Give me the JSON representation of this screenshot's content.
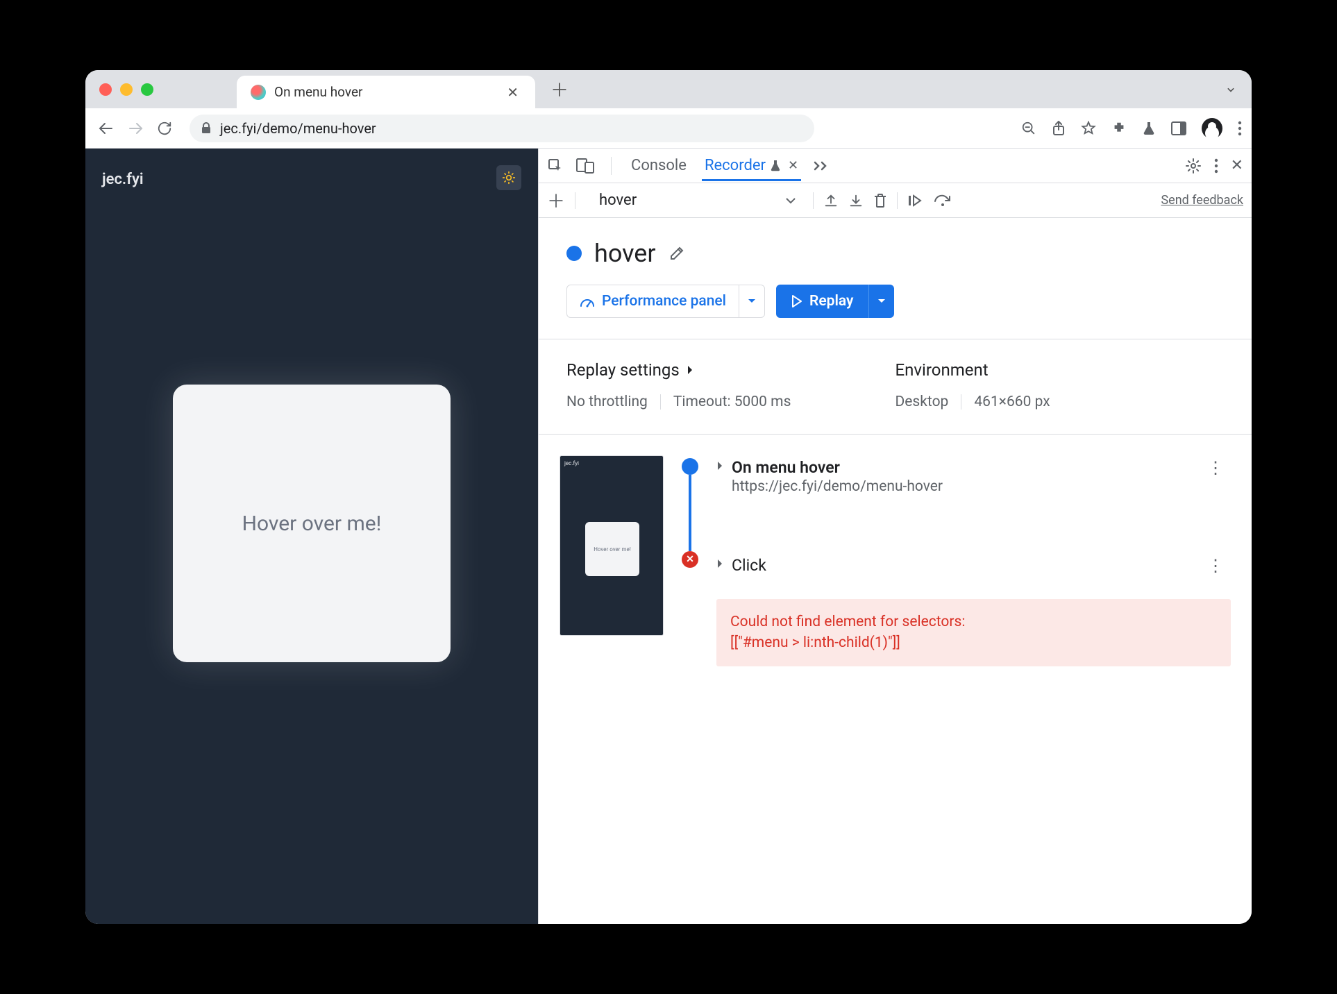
{
  "browser": {
    "tab_title": "On menu hover",
    "url": "jec.fyi/demo/menu-hover"
  },
  "page": {
    "header": "jec.fyi",
    "card_text": "Hover over me!"
  },
  "devtools": {
    "tabs": {
      "console": "Console",
      "recorder": "Recorder"
    },
    "recording_name": "hover",
    "feedback": "Send feedback",
    "title": "hover",
    "perf_button": "Performance panel",
    "replay_button": "Replay",
    "settings": {
      "replay_heading": "Replay settings",
      "throttling": "No throttling",
      "timeout": "Timeout: 5000 ms",
      "env_heading": "Environment",
      "env_device": "Desktop",
      "env_dims": "461×660 px"
    },
    "thumb": {
      "label": "jec.fyi",
      "card": "Hover over me!"
    },
    "steps": [
      {
        "title": "On menu hover",
        "url": "https://jec.fyi/demo/menu-hover"
      },
      {
        "title": "Click"
      }
    ],
    "error_line1": "Could not find element for selectors:",
    "error_line2": "[[\"#menu > li:nth-child(1)\"]]"
  }
}
